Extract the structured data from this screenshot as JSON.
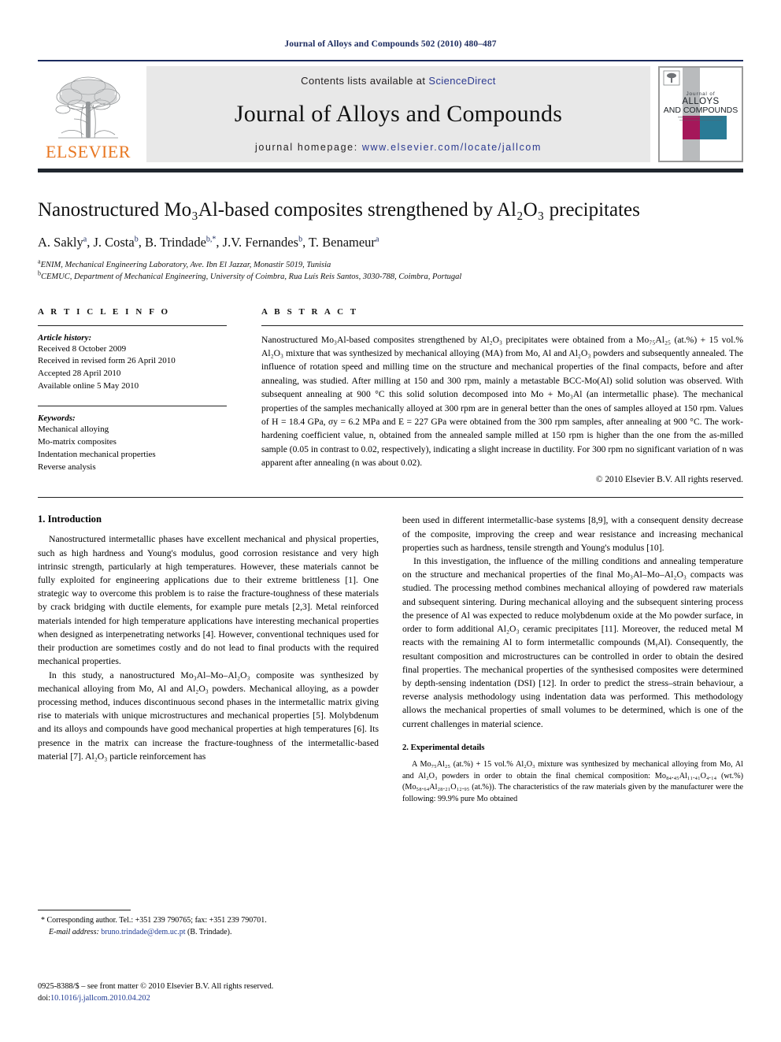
{
  "running_head": "Journal of Alloys and Compounds 502 (2010) 480–487",
  "masthead": {
    "publisher_name": "ELSEVIER",
    "contents_prefix": "Contents lists available at",
    "contents_link": "ScienceDirect",
    "journal_title": "Journal of Alloys and Compounds",
    "homepage_label": "journal homepage:",
    "homepage_url": "www.elsevier.com/locate/jallcom",
    "cover": {
      "line1": "Journal of",
      "line2": "ALLOYS",
      "line3": "AND COMPOUNDS",
      "sub1": "",
      "colors": {
        "magenta": "#a5175a",
        "teal": "#2a7b96",
        "grey": "#b9bbbd"
      }
    },
    "link_color": "#2b3990",
    "rule_color": "#1b2a5e",
    "elsevier_orange": "#e87722"
  },
  "title": "Nanostructured Mo₃Al-based composites strengthened by Al₂O₃ precipitates",
  "authors": [
    {
      "name": "A. Sakly",
      "marks": "a"
    },
    {
      "name": "J. Costa",
      "marks": "b"
    },
    {
      "name": "B. Trindade",
      "marks": "b,*"
    },
    {
      "name": "J.V. Fernandes",
      "marks": "b"
    },
    {
      "name": "T. Benameur",
      "marks": "a"
    }
  ],
  "affiliations": [
    {
      "mark": "a",
      "text": "ENIM, Mechanical Engineering Laboratory, Ave. Ibn El Jazzar, Monastir 5019, Tunisia"
    },
    {
      "mark": "b",
      "text": "CEMUC, Department of Mechanical Engineering, University of Coimbra, Rua Luís Reis Santos, 3030-788, Coimbra, Portugal"
    }
  ],
  "article_info": {
    "heading": "A R T I C L E   I N F O",
    "history_label": "Article history:",
    "history": [
      "Received 8 October 2009",
      "Received in revised form 26 April 2010",
      "Accepted 28 April 2010",
      "Available online 5 May 2010"
    ],
    "keywords_label": "Keywords:",
    "keywords": [
      "Mechanical alloying",
      "Mo-matrix composites",
      "Indentation mechanical properties",
      "Reverse analysis"
    ]
  },
  "abstract": {
    "heading": "A B S T R A C T",
    "text": "Nanostructured Mo₃Al-based composites strengthened by Al₂O₃ precipitates were obtained from a Mo₇₅Al₂₅ (at.%) + 15 vol.% Al₂O₃ mixture that was synthesized by mechanical alloying (MA) from Mo, Al and Al₂O₃ powders and subsequently annealed. The influence of rotation speed and milling time on the structure and mechanical properties of the final compacts, before and after annealing, was studied. After milling at 150 and 300 rpm, mainly a metastable BCC-Mo(Al) solid solution was observed. With subsequent annealing at 900 °C this solid solution decomposed into Mo + Mo₃Al (an intermetallic phase). The mechanical properties of the samples mechanically alloyed at 300 rpm are in general better than the ones of samples alloyed at 150 rpm. Values of H = 18.4 GPa, σy = 6.2 MPa and E = 227 GPa were obtained from the 300 rpm samples, after annealing at 900 °C. The work-hardening coefficient value, n, obtained from the annealed sample milled at 150 rpm is higher than the one from the as-milled sample (0.05 in contrast to 0.02, respectively), indicating a slight increase in ductility. For 300 rpm no significant variation of n was apparent after annealing (n was about 0.02).",
    "copyright": "© 2010 Elsevier B.V. All rights reserved."
  },
  "sections": {
    "introduction_heading": "1. Introduction",
    "intro_p1": "Nanostructured intermetallic phases have excellent mechanical and physical properties, such as high hardness and Young's modulus, good corrosion resistance and very high intrinsic strength, particularly at high temperatures. However, these materials cannot be fully exploited for engineering applications due to their extreme brittleness [1]. One strategic way to overcome this problem is to raise the fracture-toughness of these materials by crack bridging with ductile elements, for example pure metals [2,3]. Metal reinforced materials intended for high temperature applications have interesting mechanical properties when designed as interpenetrating networks [4]. However, conventional techniques used for their production are sometimes costly and do not lead to final products with the required mechanical properties.",
    "intro_p2": "In this study, a nanostructured Mo₃Al–Mo–Al₂O₃ composite was synthesized by mechanical alloying from Mo, Al and Al₂O₃ powders. Mechanical alloying, as a powder processing method, induces discontinuous second phases in the intermetallic matrix giving rise to materials with unique microstructures and mechanical properties [5]. Molybdenum and its alloys and compounds have good mechanical properties at high temperatures [6]. Its presence in the matrix can increase the fracture-toughness of the intermetallic-based material [7]. Al₂O₃ particle reinforcement has",
    "intro_p3": "been used in different intermetallic-base systems [8,9], with a consequent density decrease of the composite, improving the creep and wear resistance and increasing mechanical properties such as hardness, tensile strength and Young's modulus [10].",
    "intro_p4": "In this investigation, the influence of the milling conditions and annealing temperature on the structure and mechanical properties of the final Mo₃Al–Mo–Al₂O₃ compacts was studied. The processing method combines mechanical alloying of powdered raw materials and subsequent sintering. During mechanical alloying and the subsequent sintering process the presence of Al was expected to reduce molybdenum oxide at the Mo powder surface, in order to form additional Al₂O₃ ceramic precipitates [11]. Moreover, the reduced metal M reacts with the remaining Al to form intermetallic compounds (MᵧAl). Consequently, the resultant composition and microstructures can be controlled in order to obtain the desired final properties. The mechanical properties of the synthesised composites were determined by depth-sensing indentation (DSI) [12]. In order to predict the stress–strain behaviour, a reverse analysis methodology using indentation data was performed. This methodology allows the mechanical properties of small volumes to be determined, which is one of the current challenges in material science.",
    "experimental_heading": "2. Experimental details",
    "experimental_p1": "A Mo₇₅Al₂₅ (at.%) + 15 vol.% Al₂O₃ mixture was synthesized by mechanical alloying from Mo, Al and Al₂O₃ powders in order to obtain the final chemical composition: Mo₈₄.₄₅Al₁₁.₄₁O₄.₁₄ (wt.%) (Mo₅₈.₆₄Al₂₈.₂₁O₁₂.₉₅ (at.%)). The characteristics of the raw materials given by the manufacturer were the following: 99.9% pure Mo obtained"
  },
  "footnote": {
    "star": "*",
    "corresponding": "Corresponding author. Tel.: +351 239 790765; fax: +351 239 790701.",
    "email_label": "E-mail address:",
    "email": "bruno.trindade@dem.uc.pt",
    "email_suffix": "(B. Trindade)."
  },
  "imprint": {
    "line1": "0925-8388/$ – see front matter © 2010 Elsevier B.V. All rights reserved.",
    "doi_label": "doi:",
    "doi": "10.1016/j.jallcom.2010.04.202"
  }
}
